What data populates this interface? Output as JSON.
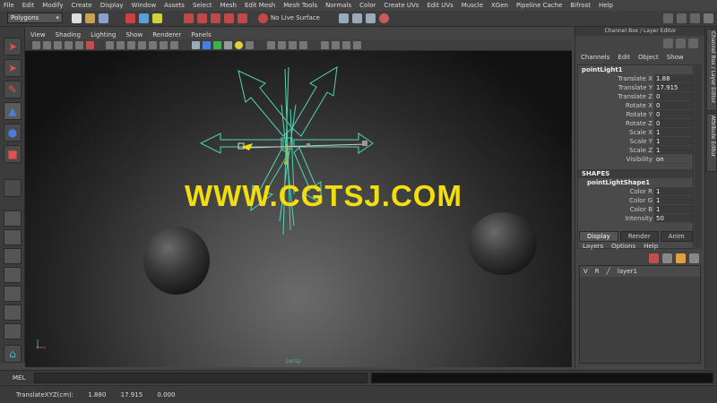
{
  "menus": [
    "File",
    "Edit",
    "Modify",
    "Create",
    "Display",
    "Window",
    "Assets",
    "Select",
    "Mesh",
    "Edit Mesh",
    "Mesh Tools",
    "Normals",
    "Color",
    "Create UVs",
    "Edit UVs",
    "Muscle",
    "XGen",
    "Pipeline Cache",
    "Bifrost",
    "Help"
  ],
  "status_line": {
    "mode": "Polygons",
    "live_surface": "No Live Surface"
  },
  "viewport": {
    "menus": [
      "View",
      "Shading",
      "Lighting",
      "Show",
      "Renderer",
      "Panels"
    ],
    "camera_label": "persp",
    "watermark": "WWW.CGTSJ.COM"
  },
  "channel_box": {
    "title": "Channel Box / Layer Editor",
    "menus": [
      "Channels",
      "Edit",
      "Object",
      "Show"
    ],
    "node": "pointLight1",
    "transform_attrs": [
      {
        "label": "Translate X",
        "value": "1.88"
      },
      {
        "label": "Translate Y",
        "value": "17.915"
      },
      {
        "label": "Translate Z",
        "value": "0"
      },
      {
        "label": "Rotate X",
        "value": "0"
      },
      {
        "label": "Rotate Y",
        "value": "0"
      },
      {
        "label": "Rotate Z",
        "value": "0"
      },
      {
        "label": "Scale X",
        "value": "1"
      },
      {
        "label": "Scale Y",
        "value": "1"
      },
      {
        "label": "Scale Z",
        "value": "1"
      },
      {
        "label": "Visibility",
        "value": "on"
      }
    ],
    "shapes_header": "SHAPES",
    "shape_node": "pointLightShape1",
    "shape_attrs": [
      {
        "label": "Color R",
        "value": "1"
      },
      {
        "label": "Color G",
        "value": "1"
      },
      {
        "label": "Color B",
        "value": "1"
      },
      {
        "label": "Intensity",
        "value": "50"
      }
    ]
  },
  "layer_editor": {
    "tabs": [
      "Display",
      "Render",
      "Anim"
    ],
    "active_tab": "Display",
    "menus": [
      "Layers",
      "Options",
      "Help"
    ],
    "layers": [
      {
        "v": "V",
        "r": "R",
        "name": "layer1"
      }
    ]
  },
  "side_tabs": [
    "Channel Box / Layer Editor",
    "Attribute Editor"
  ],
  "command_line": {
    "label": "MEL"
  },
  "help_line": {
    "label": "TranslateXYZ(cm):",
    "x": "1.880",
    "y": "17.915",
    "z": "0.000"
  },
  "colors": {
    "manipulator": "#4fd6b4",
    "watermark": "#f2dd0f",
    "background": "#444444"
  }
}
